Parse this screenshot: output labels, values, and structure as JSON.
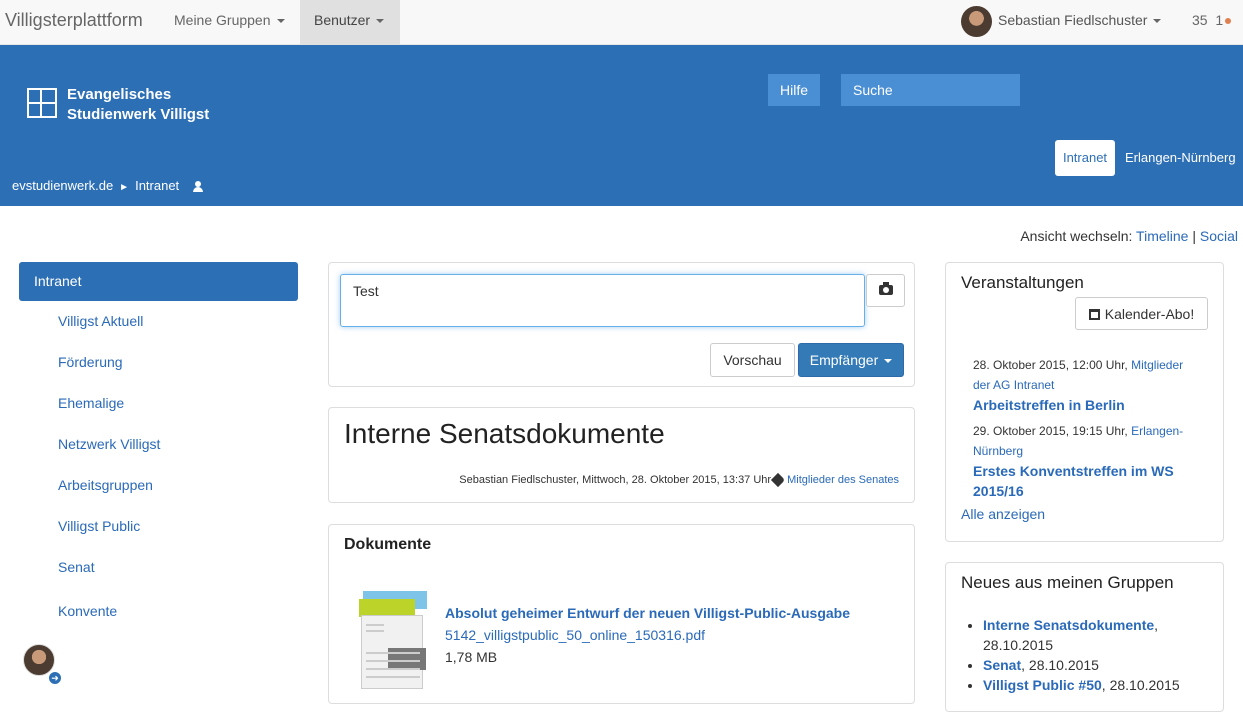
{
  "topnav": {
    "brand": "Villigsterplattform",
    "groups": "Meine Gruppen",
    "users": "Benutzer",
    "user_name": "Sebastian Fiedlschuster",
    "count_a": "35",
    "count_b": "1"
  },
  "header": {
    "logo_line1": "Evangelisches",
    "logo_line2": "Studienwerk Villigst",
    "help": "Hilfe",
    "search_placeholder": "Suche",
    "tab_active": "Intranet",
    "tab_other": "Erlangen-Nürnberg",
    "breadcrumb": [
      "evstudienwerk.de",
      "Intranet"
    ]
  },
  "view_switch": {
    "label": "Ansicht wechseln:",
    "option1": "Timeline",
    "separator": "|",
    "option2": "Social"
  },
  "sidebar": {
    "active": "Intranet",
    "items": [
      "Villigst Aktuell",
      "Förderung",
      "Ehemalige",
      "Netzwerk Villigst",
      "Arbeitsgruppen",
      "Villigst Public",
      "Senat",
      "Konvente"
    ]
  },
  "composer": {
    "text": "Test",
    "preview": "Vorschau",
    "recipients": "Empfänger"
  },
  "post": {
    "title": "Interne Senatsdokumente",
    "author_date": "Sebastian Fiedlschuster, Mittwoch, 28. Oktober 2015, 13:37 Uhr",
    "group": "Mitglieder des Senates"
  },
  "documents": {
    "title": "Dokumente",
    "doc_title": "Absolut geheimer Entwurf der neuen Villigst-Public-Ausgabe",
    "file": "5142_villigstpublic_50_online_150316.pdf",
    "size": "1,78 MB"
  },
  "events": {
    "title": "Veranstaltungen",
    "calendar_button": "Kalender-Abo!",
    "items": [
      {
        "date": "28. Oktober 2015, 12:00 Uhr,",
        "group": "Mitglieder der AG Intranet",
        "title": "Arbeitstreffen in Berlin"
      },
      {
        "date": "29. Oktober 2015, 19:15 Uhr,",
        "group": "Erlangen-Nürnberg",
        "title": "Erstes Konventstreffen im WS 2015/16"
      }
    ],
    "show_all": "Alle anzeigen"
  },
  "news": {
    "title": "Neues aus meinen Gruppen",
    "items": [
      {
        "link": "Interne Senatsdokumente",
        "suffix": ", 28.10.2015"
      },
      {
        "link": "Senat",
        "suffix": ", 28.10.2015"
      },
      {
        "link": "Villigst Public #50",
        "suffix": ", 28.10.2015"
      }
    ]
  }
}
